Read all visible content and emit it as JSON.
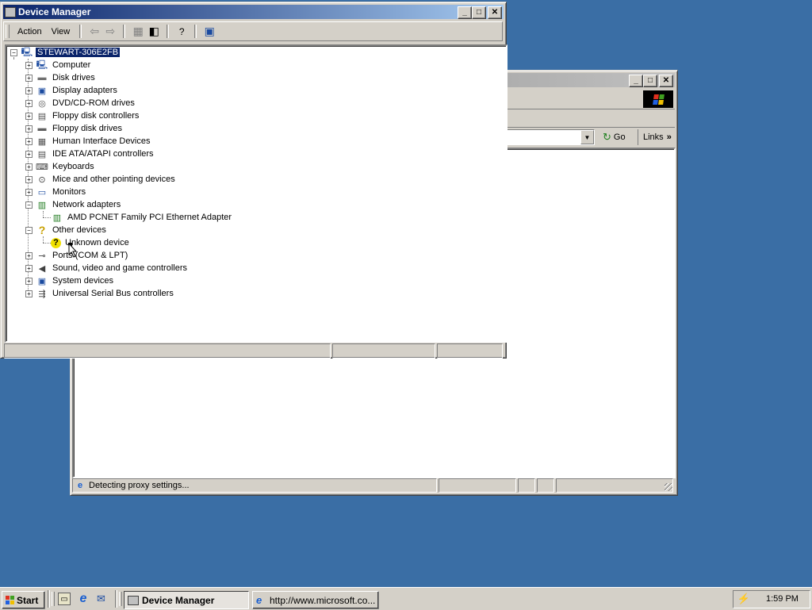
{
  "device_manager": {
    "title": "Device Manager",
    "menu": {
      "action": "Action",
      "view": "View"
    },
    "tree": {
      "root": "STEWART-306E2FB",
      "items": [
        {
          "label": "Computer",
          "icon": "computer-icon",
          "expand": "+"
        },
        {
          "label": "Disk drives",
          "icon": "disk-drive-icon",
          "expand": "+"
        },
        {
          "label": "Display adapters",
          "icon": "display-icon",
          "expand": "+"
        },
        {
          "label": "DVD/CD-ROM drives",
          "icon": "cdrom-icon",
          "expand": "+"
        },
        {
          "label": "Floppy disk controllers",
          "icon": "controller-icon",
          "expand": "+"
        },
        {
          "label": "Floppy disk drives",
          "icon": "floppy-icon",
          "expand": "+"
        },
        {
          "label": "Human Interface Devices",
          "icon": "hid-icon",
          "expand": "+"
        },
        {
          "label": "IDE ATA/ATAPI controllers",
          "icon": "ide-icon",
          "expand": "+"
        },
        {
          "label": "Keyboards",
          "icon": "keyboard-icon",
          "expand": "+"
        },
        {
          "label": "Mice and other pointing devices",
          "icon": "mouse-icon",
          "expand": "+"
        },
        {
          "label": "Monitors",
          "icon": "monitor-icon",
          "expand": "+"
        },
        {
          "label": "Network adapters",
          "icon": "network-card-icon",
          "expand": "-"
        },
        {
          "label": "AMD PCNET Family PCI Ethernet Adapter",
          "icon": "network-card-icon",
          "child": true
        },
        {
          "label": "Other devices",
          "icon": "question-icon",
          "expand": "-"
        },
        {
          "label": "Unknown device",
          "icon": "unknown-device-icon",
          "child": true
        },
        {
          "label": "Ports (COM & LPT)",
          "icon": "port-icon",
          "expand": "+"
        },
        {
          "label": "Sound, video and game controllers",
          "icon": "speaker-icon",
          "expand": "+"
        },
        {
          "label": "System devices",
          "icon": "system-icon",
          "expand": "+"
        },
        {
          "label": "Universal Serial Bus controllers",
          "icon": "usb-icon",
          "expand": "+"
        }
      ]
    }
  },
  "browser": {
    "go_label": "Go",
    "links_label": "Links",
    "status_text": "Detecting proxy settings..."
  },
  "taskbar": {
    "start_label": "Start",
    "tasks": [
      {
        "label": "Device Manager"
      },
      {
        "label": "http://www.microsoft.co..."
      }
    ],
    "clock": "1:59 PM"
  }
}
